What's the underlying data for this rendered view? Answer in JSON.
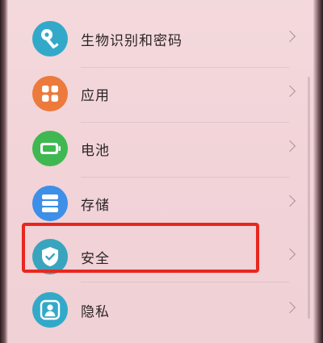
{
  "settings": {
    "items": [
      {
        "label": "生物识别和密码",
        "icon": "key-icon",
        "color": "#33a9c9"
      },
      {
        "label": "应用",
        "icon": "apps-grid-icon",
        "color": "#ec7a3c"
      },
      {
        "label": "电池",
        "icon": "battery-icon",
        "color": "#3fb852"
      },
      {
        "label": "存储",
        "icon": "storage-icon",
        "color": "#3d8fe8"
      },
      {
        "label": "安全",
        "icon": "shield-check-icon",
        "color": "#3aa4be"
      },
      {
        "label": "隐私",
        "icon": "privacy-person-icon",
        "color": "#33a9c9"
      }
    ],
    "highlight_color": "#e8271f",
    "highlighted_item": "安全"
  }
}
